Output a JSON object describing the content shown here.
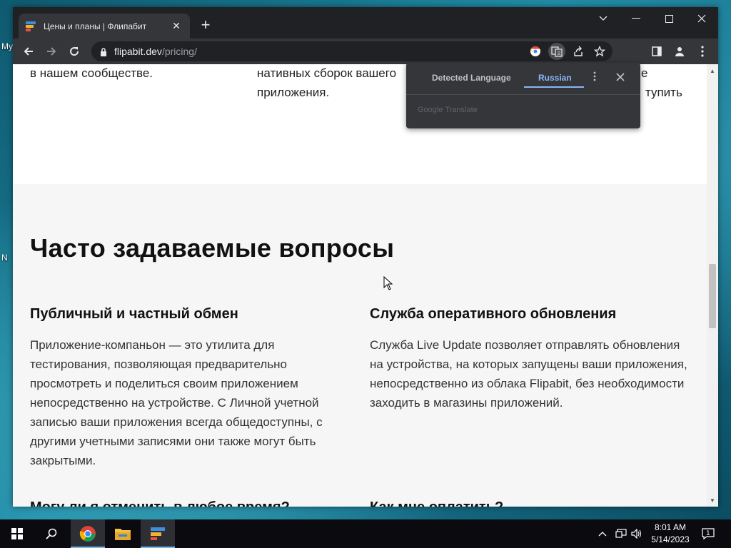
{
  "desktop": {
    "icon_labels": [
      "My",
      "N"
    ]
  },
  "browser": {
    "tab_title": "Цены и планы | Флипабит",
    "url_domain": "flipabit.dev",
    "url_path": "/pricing/",
    "translate_popup": {
      "tab_detected": "Detected Language",
      "tab_target": "Russian",
      "footer": "Google Translate"
    }
  },
  "page": {
    "top_fragments": {
      "col1": "в нашем сообществе.",
      "col2_line1": "нативных сборок вашего",
      "col2_line2": "приложения.",
      "col3_line1": "е",
      "col3_line2": "тупить"
    },
    "faq_title": "Часто задаваемые вопросы",
    "faq": [
      {
        "question": "Публичный и частный обмен",
        "answer": "Приложение-компаньон — это утилита для тестирования, позволяющая предварительно просмотреть и поделиться своим приложением непосредственно на устройстве. С Личной учетной записью ваши приложения всегда общедоступны, с другими учетными записями они также могут быть закрытыми."
      },
      {
        "question": "Служба оперативного обновления",
        "answer": "Служба Live Update позволяет отправлять обновления на устройства, на которых запущены ваши приложения, непосредственно из облака Flipabit, без необходимости заходить в магазины приложений."
      },
      {
        "question": "Могу ли я отменить в любое время?"
      },
      {
        "question": "Как мне оплатить?"
      }
    ]
  },
  "taskbar": {
    "time": "8:01 AM",
    "date": "5/14/2023",
    "notification_count": "1"
  },
  "colors": {
    "accent": "#8ab4f8",
    "chrome_dark": "#202124",
    "chrome_toolbar": "#35363a"
  }
}
